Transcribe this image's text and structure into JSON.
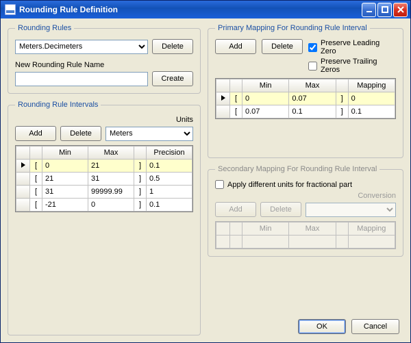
{
  "window": {
    "title": "Rounding Rule Definition"
  },
  "rules": {
    "legend": "Rounding Rules",
    "selected": "Meters.Decimeters",
    "delete": "Delete",
    "new_label": "New Rounding Rule Name",
    "new_value": "",
    "create": "Create"
  },
  "intervals": {
    "legend": "Rounding Rule Intervals",
    "units_label": "Units",
    "add": "Add",
    "delete": "Delete",
    "units_selected": "Meters",
    "headers": {
      "min": "Min",
      "max": "Max",
      "precision": "Precision"
    },
    "rows": [
      {
        "lb": "[",
        "min": "0",
        "max": "21",
        "rb": "]",
        "precision": "0.1",
        "selected": true
      },
      {
        "lb": "[",
        "min": "21",
        "max": "31",
        "rb": "]",
        "precision": "0.5",
        "selected": false
      },
      {
        "lb": "[",
        "min": "31",
        "max": "99999.99",
        "rb": "]",
        "precision": "1",
        "selected": false
      },
      {
        "lb": "[",
        "min": "-21",
        "max": "0",
        "rb": "]",
        "precision": "0.1",
        "selected": false
      }
    ]
  },
  "primary": {
    "legend": "Primary Mapping For Rounding Rule Interval",
    "add": "Add",
    "delete": "Delete",
    "preserve_leading": {
      "label": "Preserve Leading Zero",
      "checked": true
    },
    "preserve_trailing": {
      "label": "Preserve Trailing Zeros",
      "checked": false
    },
    "headers": {
      "min": "Min",
      "max": "Max",
      "mapping": "Mapping"
    },
    "rows": [
      {
        "lb": "[",
        "min": "0",
        "max": "0.07",
        "rb": "]",
        "mapping": "0",
        "selected": true
      },
      {
        "lb": "[",
        "min": "0.07",
        "max": "0.1",
        "rb": "]",
        "mapping": "0.1",
        "selected": false
      }
    ]
  },
  "secondary": {
    "legend": "Secondary Mapping For Rounding Rule Interval",
    "apply_label": "Apply different units for fractional part",
    "apply_checked": false,
    "conversion_label": "Conversion",
    "add": "Add",
    "delete": "Delete",
    "headers": {
      "min": "Min",
      "max": "Max",
      "mapping": "Mapping"
    }
  },
  "footer": {
    "ok": "OK",
    "cancel": "Cancel"
  }
}
